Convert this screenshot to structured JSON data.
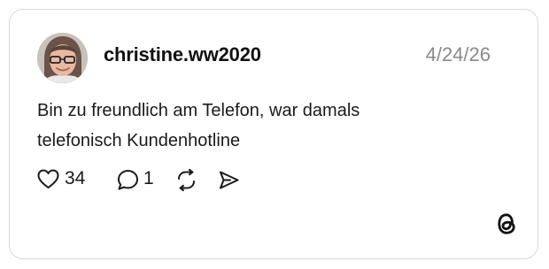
{
  "post": {
    "username": "christine.ww2020",
    "date": "4/24/26",
    "text_lines": [
      "Bin zu freundlich am Telefon, war damals",
      "telefonisch Kundenhotline"
    ],
    "likes": "34",
    "replies": "1"
  },
  "icons": {
    "like": "heart-icon",
    "reply": "speech-bubble-icon",
    "repost": "repost-icon",
    "share": "send-icon",
    "brand": "threads-logo-icon"
  },
  "colors": {
    "text": "#111111",
    "muted": "#8a8a8a",
    "border": "#d9d9d9"
  }
}
